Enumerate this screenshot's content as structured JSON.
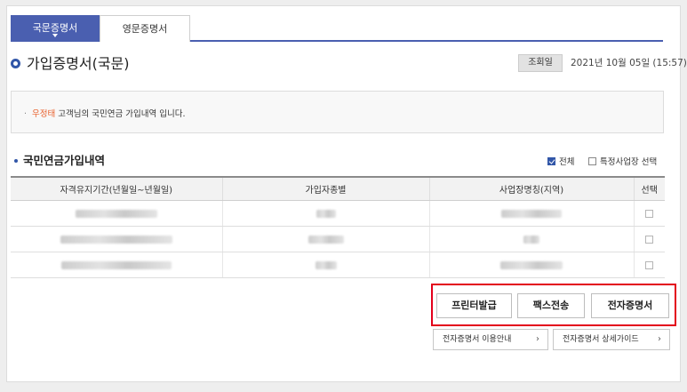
{
  "tabs": [
    {
      "label": "국문증명서",
      "active": true
    },
    {
      "label": "영문증명서",
      "active": false
    }
  ],
  "page": {
    "title": "가입증명서(국문)",
    "query_label": "조회일",
    "query_date": "2021년 10월 05일 (15:57)"
  },
  "notice": {
    "bullet": "·",
    "name": "우정태",
    "text": " 고객님의 국민연금 가입내역 입니다."
  },
  "section": {
    "title": "국민연금가입내역",
    "option_all": "전체",
    "option_all_checked": true,
    "option_specific": "특정사업장 선택",
    "option_specific_checked": false
  },
  "table": {
    "headers": [
      "자격유지기간(년월일~년월일)",
      "가입자종별",
      "사업장명칭(지역)",
      "선택"
    ],
    "rows": [
      {
        "period": "",
        "type": "",
        "workplace": "",
        "selected": false
      },
      {
        "period": "",
        "type": "",
        "workplace": "",
        "selected": false
      },
      {
        "period": "",
        "type": "",
        "workplace": "",
        "selected": false
      }
    ]
  },
  "actions": {
    "print": "프린터발급",
    "fax": "팩스전송",
    "ecert": "전자증명서"
  },
  "guides": {
    "usage": "전자증명서 이용안내",
    "detail": "전자증명서 상세가이드",
    "chevron": "›"
  },
  "colors": {
    "primary": "#4a5fb0",
    "highlight_name": "#e8602c",
    "action_outline": "#e3001b"
  }
}
